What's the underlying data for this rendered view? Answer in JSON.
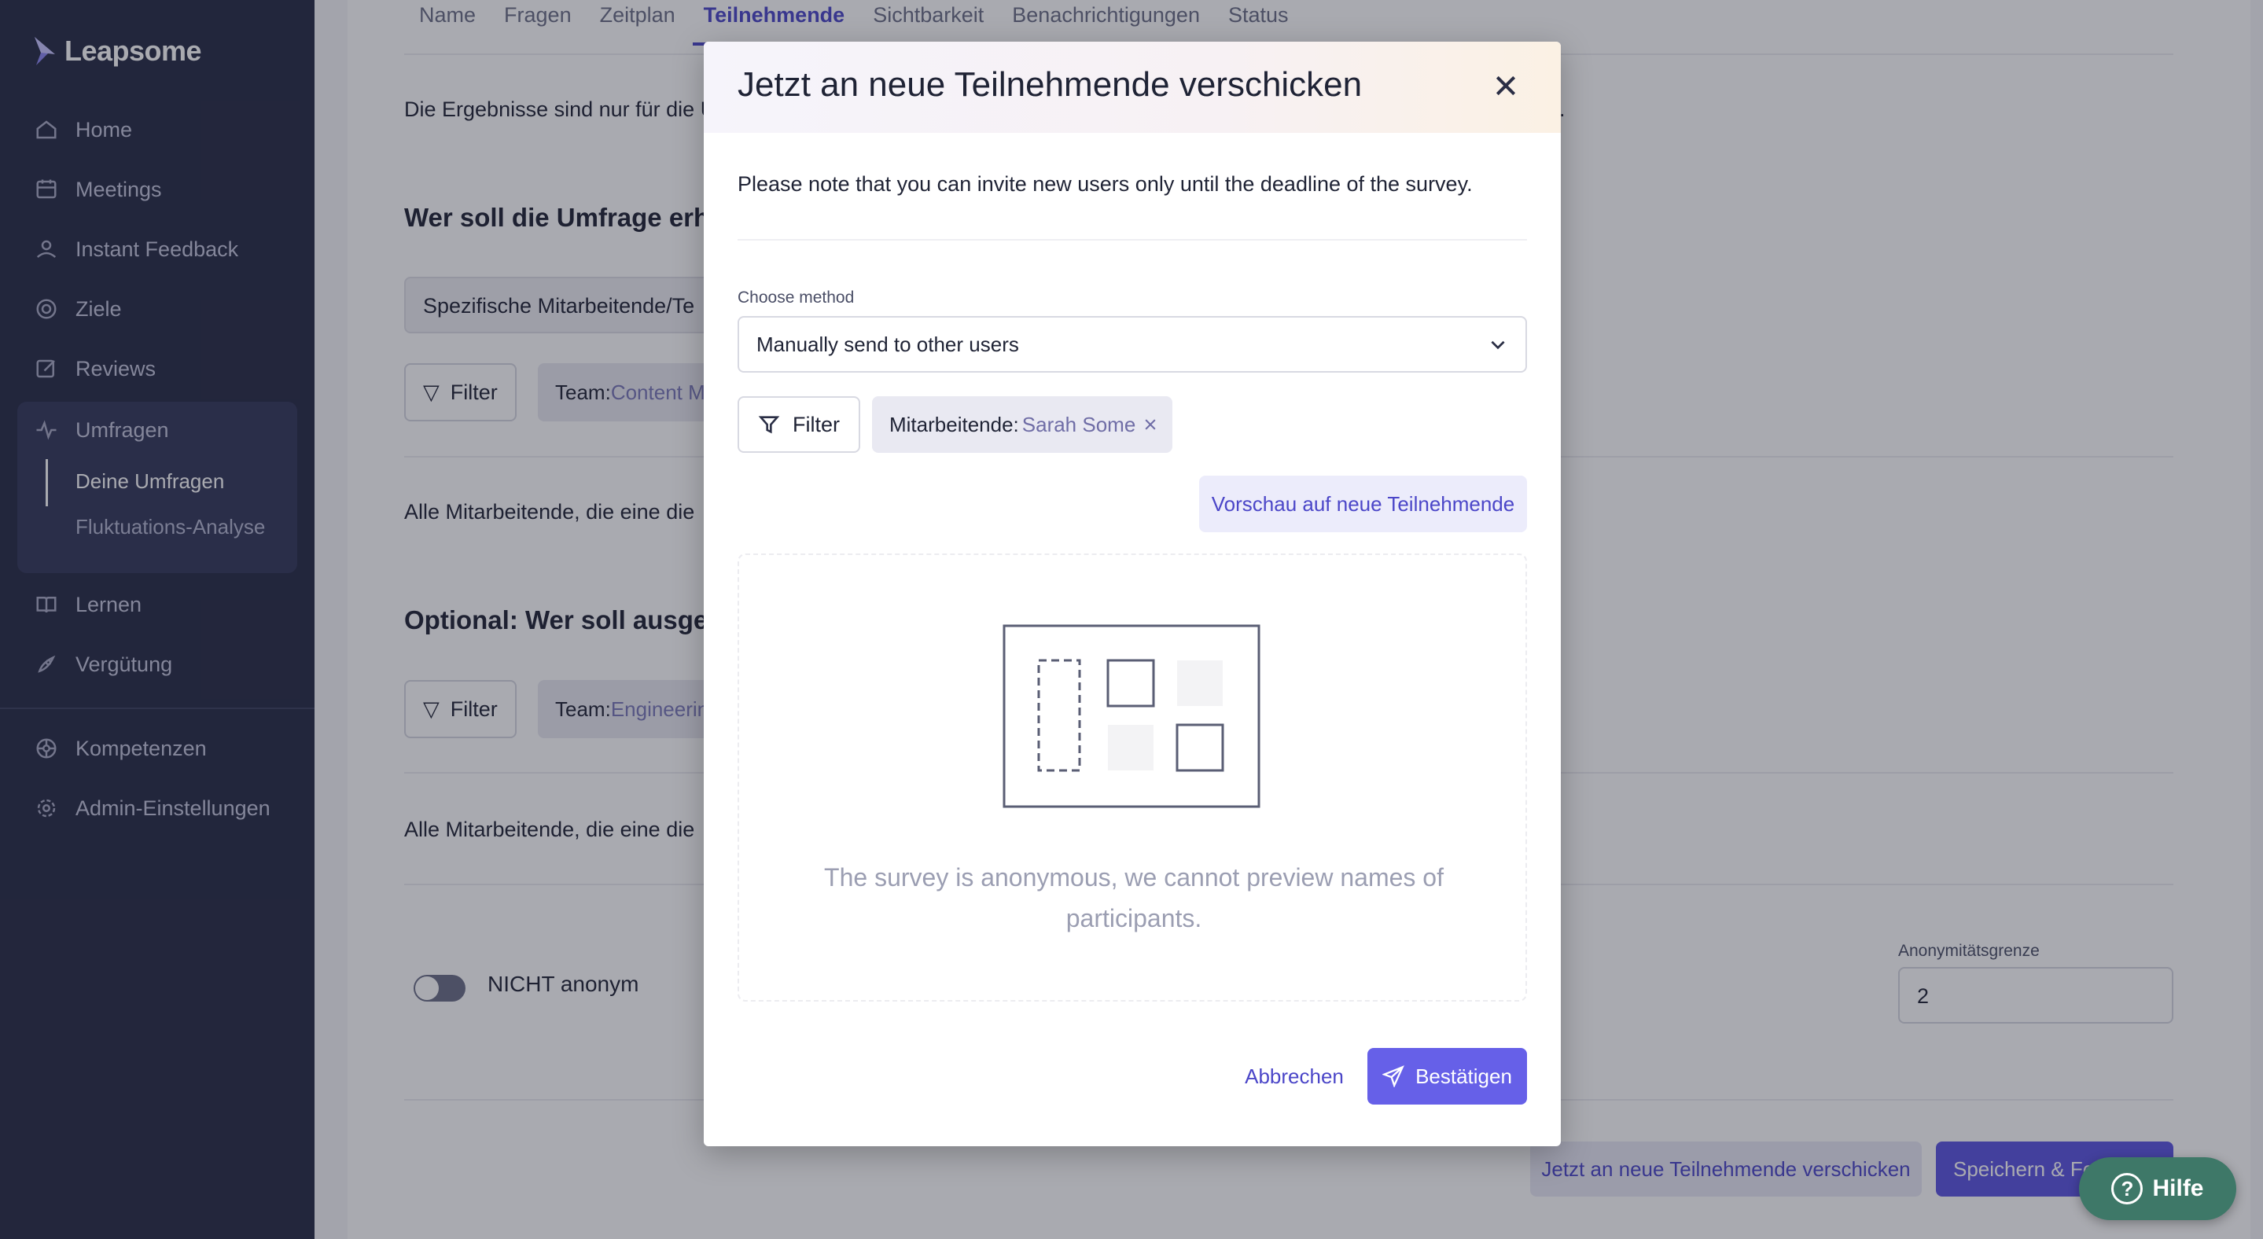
{
  "sidebar": {
    "logo_text": "Leapsome",
    "items": [
      {
        "label": "Home",
        "icon": "home-icon"
      },
      {
        "label": "Meetings",
        "icon": "meetings-icon"
      },
      {
        "label": "Instant Feedback",
        "icon": "feedback-icon"
      },
      {
        "label": "Ziele",
        "icon": "target-icon"
      },
      {
        "label": "Reviews",
        "icon": "edit-icon"
      },
      {
        "label": "Umfragen",
        "icon": "pulse-icon"
      },
      {
        "label": "Lernen",
        "icon": "book-icon"
      },
      {
        "label": "Vergütung",
        "icon": "rocket-icon"
      },
      {
        "label": "Kompetenzen",
        "icon": "network-icon"
      },
      {
        "label": "Admin-Einstellungen",
        "icon": "gear-icon"
      }
    ],
    "sub_items": [
      "Deine Umfragen",
      "Fluktuations-Analyse"
    ]
  },
  "tabs": [
    "Name",
    "Fragen",
    "Zeitplan",
    "Teilnehmende",
    "Sichtbarkeit",
    "Benachrichtigungen",
    "Status"
  ],
  "background": {
    "intro_text": "Die Ergebnisse sind nur für die U",
    "intro_text_end": "n.",
    "heading1": "Wer soll die Umfrage erha",
    "select1": "Spezifische Mitarbeitende/Te",
    "filter_label": "Filter",
    "chip1_key": "Team:",
    "chip1_val": "Content M",
    "all_employees_1": "Alle Mitarbeitende, die eine die",
    "heading2": "Optional: Wer soll ausges",
    "chip2_key": "Team:",
    "chip2_val": "Engineerin",
    "all_employees_2": "Alle Mitarbeitende, die eine die",
    "toggle_label": "NICHT anonym",
    "anon_label": "Anonymitätsgrenze",
    "anon_value": "2",
    "send_button": "Jetzt an neue Teilnehmende verschicken",
    "save_button": "Speichern & Fo"
  },
  "modal": {
    "title": "Jetzt an neue Teilnehmende verschicken",
    "note": "Please note that you can invite new users only until the deadline of the survey.",
    "method_label": "Choose method",
    "method_value": "Manually send to other users",
    "filter_label": "Filter",
    "chip_key": "Mitarbeitende:",
    "chip_value": "Sarah Some",
    "preview_button": "Vorschau auf neue Teilnehmende",
    "empty_text": "The survey is anonymous, we cannot preview names of participants.",
    "cancel_button": "Abbrechen",
    "confirm_button": "Bestätigen"
  },
  "help": {
    "label": "Hilfe",
    "icon_glyph": "?"
  },
  "colors": {
    "accent": "#5b55e0",
    "sidebar_bg": "#262a44",
    "help_bg": "#3e7868"
  }
}
